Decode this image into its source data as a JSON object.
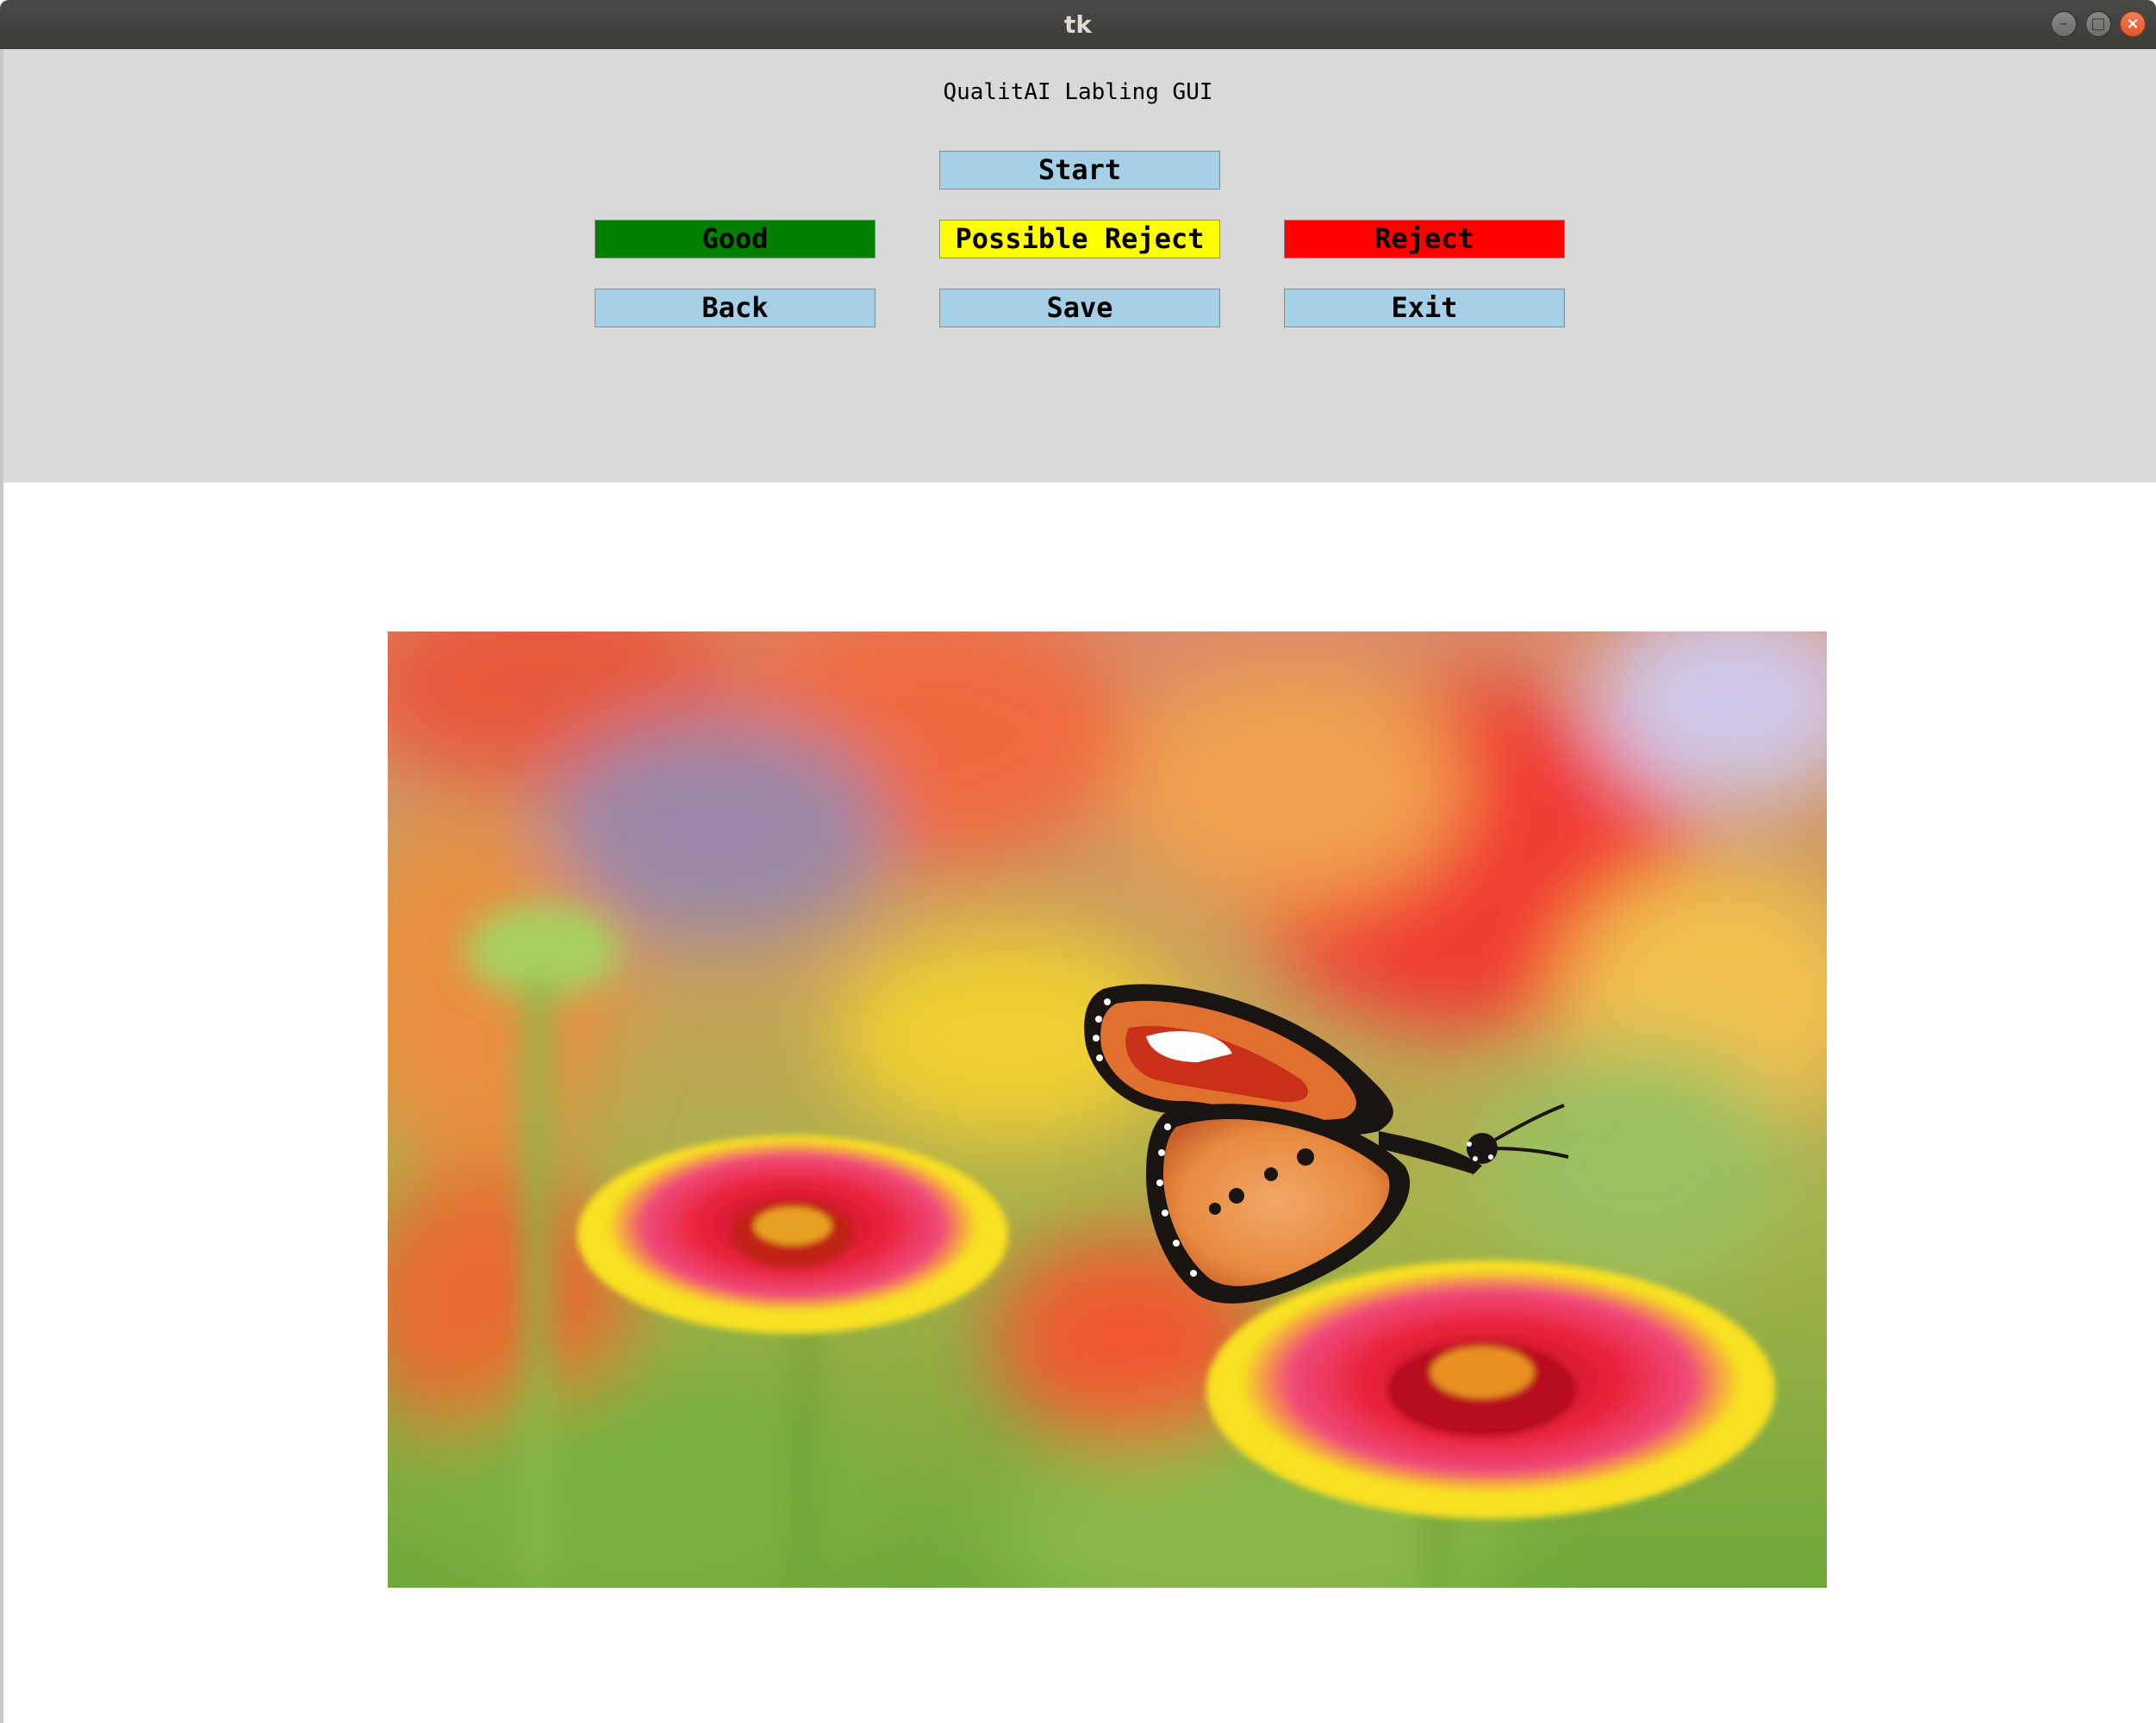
{
  "window": {
    "title": "tk"
  },
  "header": {
    "heading": "QualitAI Labling GUI"
  },
  "buttons": {
    "start": "Start",
    "good": "Good",
    "possible_reject": "Possible Reject",
    "reject": "Reject",
    "back": "Back",
    "save": "Save",
    "exit": "Exit"
  },
  "colors": {
    "panel_background": "#d9d9d9",
    "nav_button": "#a6d0e8",
    "good": "#008000",
    "possible_reject": "#ffff00",
    "reject": "#ff0000"
  },
  "image": {
    "subject": "orange butterfly on red and yellow gaillardia flowers"
  }
}
